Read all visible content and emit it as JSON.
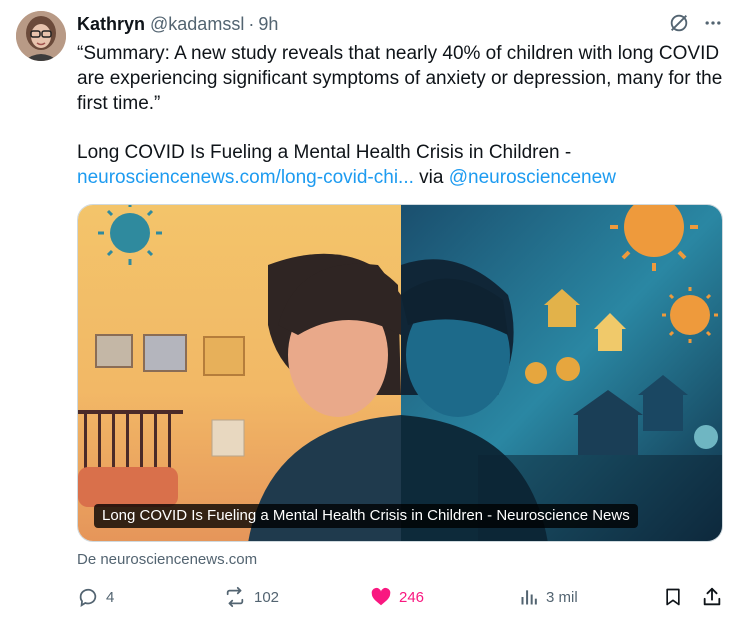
{
  "tweet": {
    "author_name": "Kathryn",
    "author_handle": "@kadamssl",
    "separator": "·",
    "time": "9h",
    "text": "“Summary: A new study reveals that nearly 40% of children with long COVID\nare experiencing significant symptoms of anxiety or depression, many for the\nfirst time.”",
    "link_title": "Long COVID Is Fueling a Mental Health Crisis in Children -",
    "link_url": "neurosciencenews.com/long-covid-chi...",
    "link_via": "via",
    "link_mention": "@neurosciencenew"
  },
  "card": {
    "title": "Long COVID Is Fueling a Mental Health Crisis in Children - Neuroscience News",
    "source": "De neurosciencenews.com"
  },
  "actions": {
    "replies": "4",
    "reposts": "102",
    "likes": "246",
    "views": "3 mil"
  },
  "icons": {
    "header_left": "grok-icon",
    "header_right": "more-icon",
    "reply": "reply-icon",
    "repost": "repost-icon",
    "like": "heart-icon",
    "views": "views-icon",
    "bookmark": "bookmark-icon",
    "share": "share-icon"
  },
  "colors": {
    "text": "#0f1419",
    "muted": "#536471",
    "link": "#1d9bf0",
    "like": "#f91880"
  }
}
